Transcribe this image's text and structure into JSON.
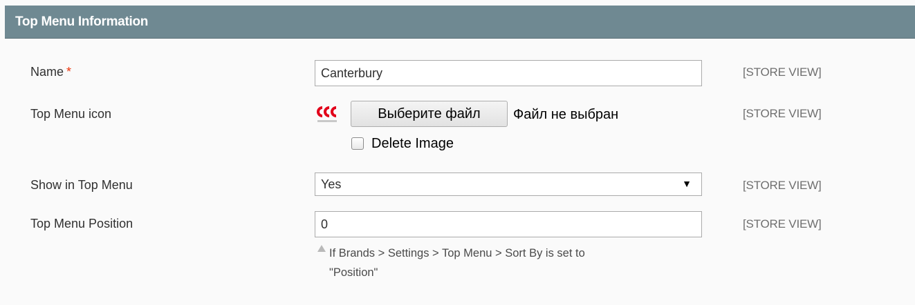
{
  "section": {
    "title": "Top Menu Information"
  },
  "fields": {
    "name": {
      "label": "Name",
      "required_mark": "*",
      "value": "Canterbury",
      "scope": "[STORE VIEW]"
    },
    "icon": {
      "label": "Top Menu icon",
      "icon_name": "canterbury-logo-icon",
      "choose_button_label": "Выберите файл",
      "file_status": "Файл не выбран",
      "delete_label": "Delete Image",
      "delete_checked": false,
      "scope": "[STORE VIEW]"
    },
    "show_in_menu": {
      "label": "Show in Top Menu",
      "selected": "Yes",
      "scope": "[STORE VIEW]"
    },
    "position": {
      "label": "Top Menu Position",
      "value": "0",
      "scope": "[STORE VIEW]",
      "note_line1": "If Brands > Settings > Top Menu > Sort By is set to",
      "note_line2": "\"Position\""
    }
  },
  "colors": {
    "header_bg": "#6f8992",
    "required": "#eb340a",
    "logo_red": "#e2001a"
  }
}
